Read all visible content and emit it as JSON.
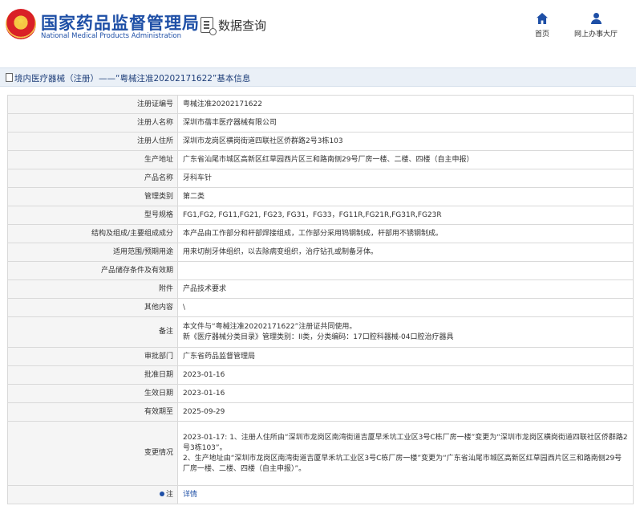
{
  "header": {
    "agency_cn": "国家药品监督管理局",
    "agency_en": "National Medical Products Administration",
    "db_title": "数据查询",
    "nav": [
      {
        "label": "首页",
        "icon": "home-icon"
      },
      {
        "label": "网上办事大厅",
        "icon": "user-icon"
      }
    ],
    "brand_color": "#1e4fa6"
  },
  "title_bar": {
    "text": "境内医疗器械（注册）——“粤械注准20202171622”基本信息"
  },
  "rows": [
    {
      "label": "注册证编号",
      "value": "粤械注准20202171622"
    },
    {
      "label": "注册人名称",
      "value": "深圳市蓓丰医疗器械有限公司"
    },
    {
      "label": "注册人住所",
      "value": "深圳市龙岗区横岗街道四联社区侨群路2号3栋103"
    },
    {
      "label": "生产地址",
      "value": "广东省汕尾市城区高新区红草园西片区三和路南侧29号厂房一楼、二楼、四楼（自主申报）"
    },
    {
      "label": "产品名称",
      "value": "牙科车针"
    },
    {
      "label": "管理类别",
      "value": "第二类"
    },
    {
      "label": "型号规格",
      "value": "FG1,FG2, FG11,FG21, FG23, FG31，FG33，FG11R,FG21R,FG31R,FG23R"
    },
    {
      "label": "结构及组成/主要组成成分",
      "value": "本产品由工作部分和杆部焊接组成，工作部分采用钨钢制成，杆部用不锈钢制成。"
    },
    {
      "label": "适用范围/预期用途",
      "value": "用来切削牙体组织，以去除病变组织，治疗钻孔或制备牙体。"
    },
    {
      "label": "产品储存条件及有效期",
      "value": ""
    },
    {
      "label": "附件",
      "value": "产品技术要求"
    },
    {
      "label": "其他内容",
      "value": "\\"
    },
    {
      "label": "备注",
      "lines": [
        "本文件与“粤械注准20202171622”注册证共同使用。",
        "新《医疗器械分类目录》管理类别：II类，分类编码：17口腔科器械-04口腔治疗器具"
      ]
    },
    {
      "label": "审批部门",
      "value": "广东省药品监督管理局"
    },
    {
      "label": "批准日期",
      "value": "2023-01-16"
    },
    {
      "label": "生效日期",
      "value": "2023-01-16"
    },
    {
      "label": "有效期至",
      "value": "2025-09-29"
    },
    {
      "label": "变更情况",
      "lines": [
        "2023-01-17: 1、注册人住所由“深圳市龙岗区南湾街道吉厦早禾坑工业区3号C栋厂房一楼”变更为“深圳市龙岗区横岗街道四联社区侨群路2号3栋103”。",
        "2、生产地址由“深圳市龙岗区南湾街道吉厦早禾坑工业区3号C栋厂房一楼”变更为“广东省汕尾市城区高新区红草园西片区三和路南侧29号厂房一楼、二楼、四楼（自主申报）”。"
      ]
    },
    {
      "label": "注",
      "value": "详情",
      "link": true
    }
  ]
}
